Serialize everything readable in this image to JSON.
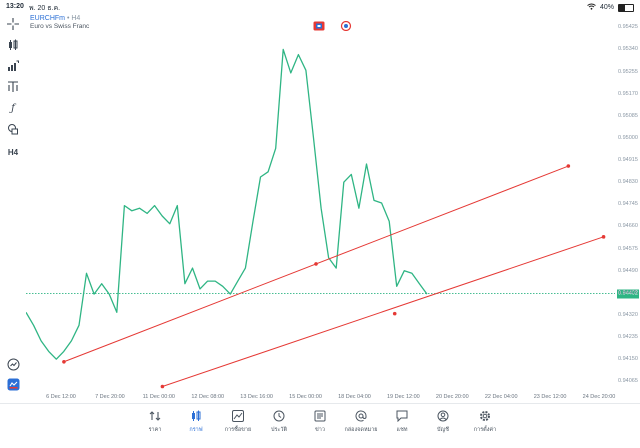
{
  "status_bar": {
    "time": "13:20",
    "date": "พ. 20 ธ.ค.",
    "battery": "40%",
    "battery_level": 0.4
  },
  "chart": {
    "symbol": "EURCHFm",
    "timeframe": "H4",
    "description": "Euro vs Swiss Franc",
    "current_price": "0.94402",
    "price_ticks": [
      "0.95425",
      "0.95340",
      "0.95255",
      "0.95170",
      "0.95085",
      "0.95000",
      "0.94915",
      "0.94830",
      "0.94745",
      "0.94660",
      "0.94575",
      "0.94490",
      "0.94405",
      "0.94320",
      "0.94235",
      "0.94150",
      "0.94065"
    ],
    "time_ticks": [
      "6 Dec 12:00",
      "7 Dec 20:00",
      "11 Dec 00:00",
      "12 Dec 08:00",
      "13 Dec 16:00",
      "15 Dec 00:00",
      "18 Dec 04:00",
      "19 Dec 12:00",
      "20 Dec 20:00",
      "22 Dec 04:00",
      "23 Dec 12:00",
      "24 Dec 20:00"
    ]
  },
  "sidebar": {
    "icons": [
      "crosshair-icon",
      "candles-icon",
      "indicators-icon",
      "lines-icon",
      "fx-icon",
      "shapes-icon",
      "timeframe-icon"
    ],
    "timeframe_label": "H4"
  },
  "navbar": {
    "items": [
      {
        "label": "ราคา",
        "icon": "quotes-icon",
        "active": false
      },
      {
        "label": "กราฟ",
        "icon": "chart-icon",
        "active": true
      },
      {
        "label": "การซื้อขาย",
        "icon": "trade-icon",
        "active": false
      },
      {
        "label": "ประวัติ",
        "icon": "history-icon",
        "active": false
      },
      {
        "label": "ข่าว",
        "icon": "news-icon",
        "active": false
      },
      {
        "label": "กล่องจดหมาย",
        "icon": "mailbox-icon",
        "active": false
      },
      {
        "label": "แชท",
        "icon": "chat-icon",
        "active": false
      },
      {
        "label": "บัญชี",
        "icon": "account-icon",
        "active": false
      },
      {
        "label": "การตั้งค่า",
        "icon": "settings-icon",
        "active": false
      }
    ]
  },
  "colors": {
    "line": "#2fb584",
    "trendline": "#e53935",
    "accent": "#2b6fd6"
  },
  "chart_data": {
    "type": "line",
    "ylim": [
      0.9402,
      0.9548
    ],
    "x_categories": [
      "6 Dec 12:00",
      "7 Dec 20:00",
      "11 Dec 00:00",
      "12 Dec 08:00",
      "13 Dec 16:00",
      "15 Dec 00:00",
      "18 Dec 04:00",
      "19 Dec 12:00",
      "20 Dec 20:00",
      "22 Dec 04:00",
      "23 Dec 12:00",
      "24 Dec 20:00"
    ],
    "series": [
      {
        "values": [
          0.9433,
          0.9428,
          0.9422,
          0.9418,
          0.9415,
          0.9418,
          0.9422,
          0.9428,
          0.9448,
          0.944,
          0.9444,
          0.944,
          0.9433,
          0.9474,
          0.9472,
          0.9473,
          0.9471,
          0.9474,
          0.947,
          0.9467,
          0.9474,
          0.9444,
          0.945,
          0.9442,
          0.9445,
          0.9445,
          0.9443,
          0.944,
          0.9445,
          0.945,
          0.9468,
          0.9485,
          0.9487,
          0.9496,
          0.9534,
          0.9525,
          0.9532,
          0.9526,
          0.95,
          0.9473,
          0.9454,
          0.945,
          0.9483,
          0.9486,
          0.9473,
          0.949,
          0.9476,
          0.9475,
          0.9468,
          0.9443,
          0.9449,
          0.9448,
          0.9444,
          0.944
        ]
      }
    ],
    "trendlines": [
      {
        "points": [
          [
            0.0644,
            0.9414
          ],
          [
            0.4924,
            0.94516
          ],
          [
            0.9208,
            0.94892
          ]
        ]
      },
      {
        "points": [
          [
            0.2316,
            0.94045
          ],
          [
            0.626,
            0.94325
          ],
          [
            0.9806,
            0.9462
          ]
        ]
      }
    ],
    "current_price_line": 0.94402
  }
}
